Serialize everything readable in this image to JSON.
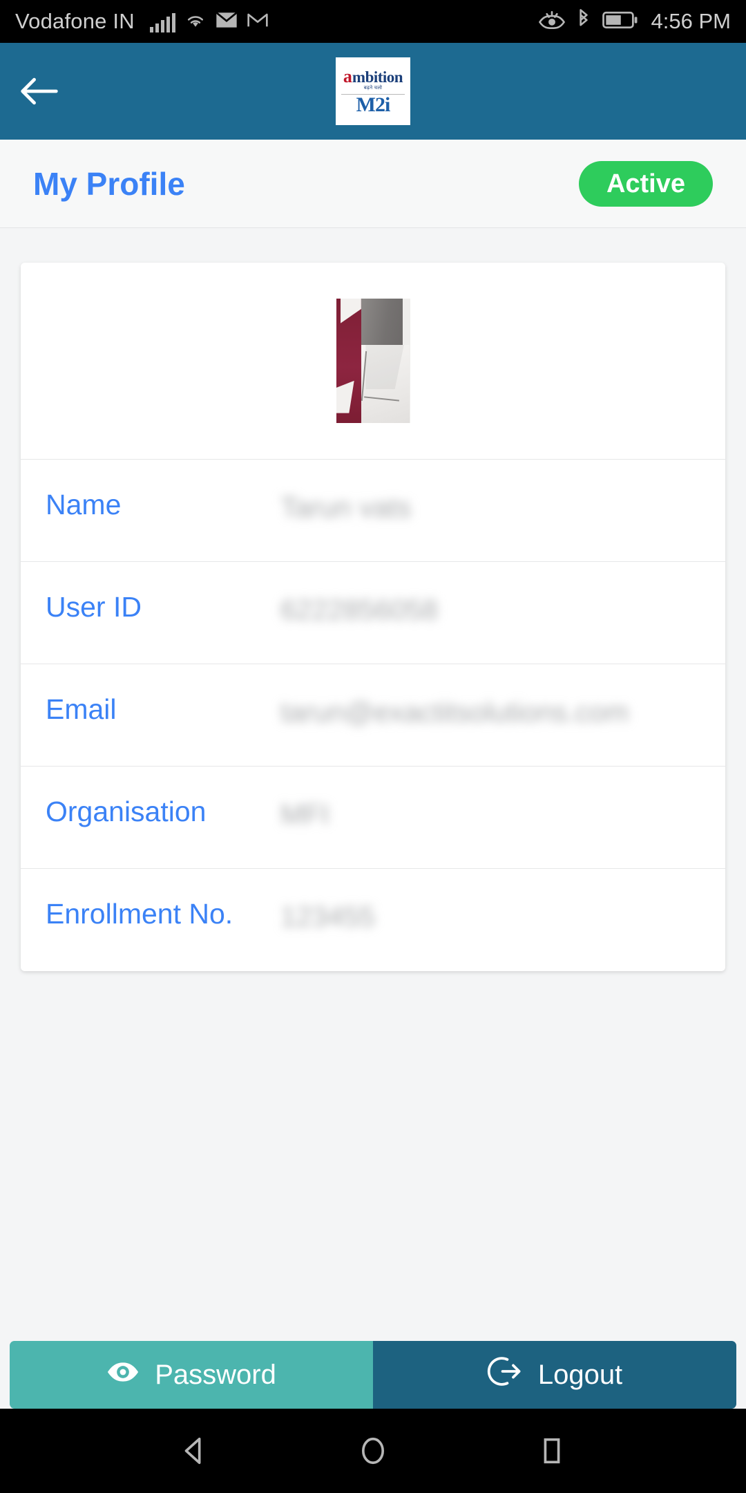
{
  "status_bar": {
    "carrier": "Vodafone IN",
    "time": "4:56 PM",
    "icons_left": [
      "signal-bars-icon",
      "wifi-icon",
      "email-icon",
      "gmail-icon"
    ],
    "icons_right": [
      "eye-care-icon",
      "bluetooth-icon",
      "battery-icon"
    ],
    "battery_level_percent": 55
  },
  "app_bar": {
    "back_label": "back",
    "logo": {
      "brand_initial": "a",
      "brand_word": "mbition",
      "tagline_hindi": "बढ़ने चलो",
      "sub_brand": "M2i"
    }
  },
  "page": {
    "title": "My Profile",
    "status_badge": "Active"
  },
  "profile": {
    "photo_alt": "profile-photo",
    "fields": [
      {
        "label": "Name",
        "value": "Tarun vats"
      },
      {
        "label": "User ID",
        "value": "6222856058"
      },
      {
        "label": "Email",
        "value": "tarun@exactitsolutions.com"
      },
      {
        "label": "Organisation",
        "value": "MFI"
      },
      {
        "label": "Enrollment No.",
        "value": "123455"
      }
    ]
  },
  "actions": {
    "password_label": "Password",
    "logout_label": "Logout"
  },
  "nav_bar": {
    "back": "back-triangle-icon",
    "home": "home-circle-icon",
    "recents": "recents-square-icon"
  },
  "colors": {
    "header_blue": "#1d6a91",
    "title_blue": "#3b82f6",
    "active_green": "#2ecc5c",
    "password_teal": "#4cb5ae",
    "logout_blue": "#1d6280"
  }
}
